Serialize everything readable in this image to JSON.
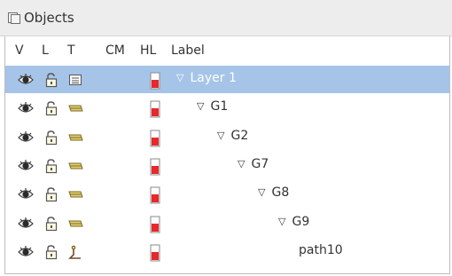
{
  "panel": {
    "title": "Objects"
  },
  "columns": {
    "v": "V",
    "l": "L",
    "t": "T",
    "cm": "CM",
    "hl": "HL",
    "label": "Label"
  },
  "colors": {
    "selection": "#a5c4e8",
    "highlight_red": "#e8282a"
  },
  "rows": [
    {
      "label": "Layer 1",
      "type_icon": "layer-icon",
      "expanded": true,
      "selected": true
    },
    {
      "label": "G1",
      "type_icon": "group-icon",
      "expanded": true,
      "selected": false
    },
    {
      "label": "G2",
      "type_icon": "group-icon",
      "expanded": true,
      "selected": false
    },
    {
      "label": "G7",
      "type_icon": "group-icon",
      "expanded": true,
      "selected": false
    },
    {
      "label": "G8",
      "type_icon": "group-icon",
      "expanded": true,
      "selected": false
    },
    {
      "label": "G9",
      "type_icon": "group-icon",
      "expanded": true,
      "selected": false
    },
    {
      "label": "path10",
      "type_icon": "path-icon",
      "expanded": false,
      "selected": false
    }
  ]
}
